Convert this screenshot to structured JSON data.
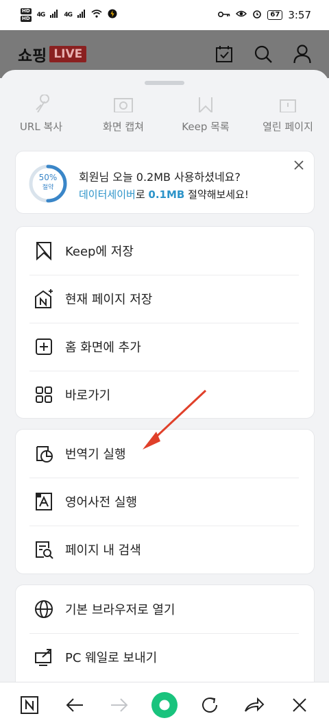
{
  "status_bar": {
    "hd1": "HD",
    "hd2": "HD",
    "signal1": "4G",
    "signal2": "4G",
    "battery": "67",
    "time": "3:57"
  },
  "header": {
    "brand": "쇼핑",
    "live": "LIVE",
    "icons": [
      "calendar-check-icon",
      "search-icon",
      "user-icon"
    ]
  },
  "quick_actions": [
    {
      "label": "URL 복사",
      "icon": "link-icon"
    },
    {
      "label": "화면 캡쳐",
      "icon": "capture-icon"
    },
    {
      "label": "Keep 목록",
      "icon": "bookmark-icon"
    },
    {
      "label": "열린 페이지",
      "icon": "tabs-icon"
    }
  ],
  "data_saver": {
    "percent": "50%",
    "percent_sub": "절약",
    "saved_fraction": 0.5,
    "line1": "회원님 오늘 0.2MB 사용하셨네요?",
    "line2_accent": "데이터세이버",
    "line2_mid": "로 ",
    "line2_amount": "0.1MB",
    "line2_tail": " 절약해보세요!"
  },
  "menu_group1": [
    {
      "label": "Keep에 저장",
      "icon": "bookmark-icon"
    },
    {
      "label": "현재 페이지 저장",
      "icon": "save-page-icon"
    },
    {
      "label": "홈 화면에 추가",
      "icon": "add-home-icon"
    },
    {
      "label": "바로가기",
      "icon": "grid-icon"
    }
  ],
  "menu_group2": [
    {
      "label": "번역기 실행",
      "icon": "translate-icon"
    },
    {
      "label": "영어사전 실행",
      "icon": "dictionary-icon"
    },
    {
      "label": "페이지 내 검색",
      "icon": "find-in-page-icon"
    }
  ],
  "menu_group3": [
    {
      "label": "기본 브라우저로 열기",
      "icon": "globe-icon"
    },
    {
      "label": "PC 웨일로 보내기",
      "icon": "send-pc-icon"
    }
  ],
  "bottom_nav": [
    "naver-home-icon",
    "back-arrow-icon",
    "forward-arrow-icon",
    "green-dot-icon",
    "refresh-icon",
    "share-icon",
    "close-icon"
  ],
  "colors": {
    "accent": "#2d94c9",
    "green": "#19c37d",
    "annotation_arrow": "#e0402a"
  }
}
